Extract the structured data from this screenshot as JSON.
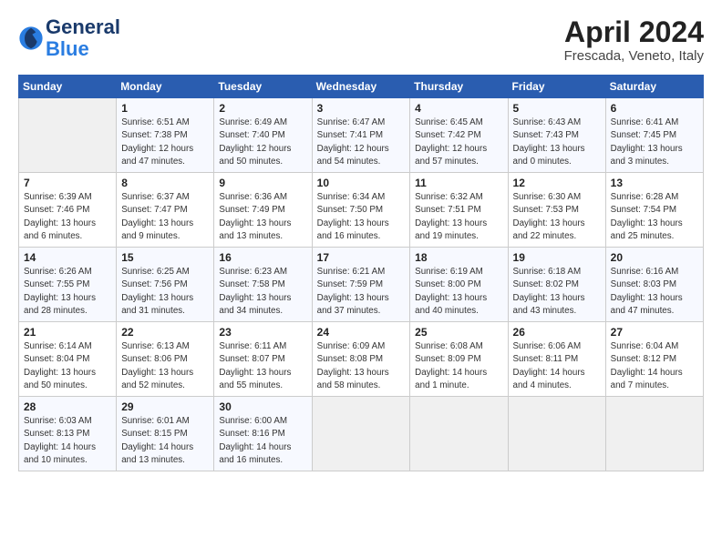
{
  "header": {
    "logo_general": "General",
    "logo_blue": "Blue",
    "title": "April 2024",
    "location": "Frescada, Veneto, Italy"
  },
  "calendar": {
    "headers": [
      "Sunday",
      "Monday",
      "Tuesday",
      "Wednesday",
      "Thursday",
      "Friday",
      "Saturday"
    ],
    "rows": [
      [
        {
          "day": "",
          "info": ""
        },
        {
          "day": "1",
          "info": "Sunrise: 6:51 AM\nSunset: 7:38 PM\nDaylight: 12 hours\nand 47 minutes."
        },
        {
          "day": "2",
          "info": "Sunrise: 6:49 AM\nSunset: 7:40 PM\nDaylight: 12 hours\nand 50 minutes."
        },
        {
          "day": "3",
          "info": "Sunrise: 6:47 AM\nSunset: 7:41 PM\nDaylight: 12 hours\nand 54 minutes."
        },
        {
          "day": "4",
          "info": "Sunrise: 6:45 AM\nSunset: 7:42 PM\nDaylight: 12 hours\nand 57 minutes."
        },
        {
          "day": "5",
          "info": "Sunrise: 6:43 AM\nSunset: 7:43 PM\nDaylight: 13 hours\nand 0 minutes."
        },
        {
          "day": "6",
          "info": "Sunrise: 6:41 AM\nSunset: 7:45 PM\nDaylight: 13 hours\nand 3 minutes."
        }
      ],
      [
        {
          "day": "7",
          "info": "Sunrise: 6:39 AM\nSunset: 7:46 PM\nDaylight: 13 hours\nand 6 minutes."
        },
        {
          "day": "8",
          "info": "Sunrise: 6:37 AM\nSunset: 7:47 PM\nDaylight: 13 hours\nand 9 minutes."
        },
        {
          "day": "9",
          "info": "Sunrise: 6:36 AM\nSunset: 7:49 PM\nDaylight: 13 hours\nand 13 minutes."
        },
        {
          "day": "10",
          "info": "Sunrise: 6:34 AM\nSunset: 7:50 PM\nDaylight: 13 hours\nand 16 minutes."
        },
        {
          "day": "11",
          "info": "Sunrise: 6:32 AM\nSunset: 7:51 PM\nDaylight: 13 hours\nand 19 minutes."
        },
        {
          "day": "12",
          "info": "Sunrise: 6:30 AM\nSunset: 7:53 PM\nDaylight: 13 hours\nand 22 minutes."
        },
        {
          "day": "13",
          "info": "Sunrise: 6:28 AM\nSunset: 7:54 PM\nDaylight: 13 hours\nand 25 minutes."
        }
      ],
      [
        {
          "day": "14",
          "info": "Sunrise: 6:26 AM\nSunset: 7:55 PM\nDaylight: 13 hours\nand 28 minutes."
        },
        {
          "day": "15",
          "info": "Sunrise: 6:25 AM\nSunset: 7:56 PM\nDaylight: 13 hours\nand 31 minutes."
        },
        {
          "day": "16",
          "info": "Sunrise: 6:23 AM\nSunset: 7:58 PM\nDaylight: 13 hours\nand 34 minutes."
        },
        {
          "day": "17",
          "info": "Sunrise: 6:21 AM\nSunset: 7:59 PM\nDaylight: 13 hours\nand 37 minutes."
        },
        {
          "day": "18",
          "info": "Sunrise: 6:19 AM\nSunset: 8:00 PM\nDaylight: 13 hours\nand 40 minutes."
        },
        {
          "day": "19",
          "info": "Sunrise: 6:18 AM\nSunset: 8:02 PM\nDaylight: 13 hours\nand 43 minutes."
        },
        {
          "day": "20",
          "info": "Sunrise: 6:16 AM\nSunset: 8:03 PM\nDaylight: 13 hours\nand 47 minutes."
        }
      ],
      [
        {
          "day": "21",
          "info": "Sunrise: 6:14 AM\nSunset: 8:04 PM\nDaylight: 13 hours\nand 50 minutes."
        },
        {
          "day": "22",
          "info": "Sunrise: 6:13 AM\nSunset: 8:06 PM\nDaylight: 13 hours\nand 52 minutes."
        },
        {
          "day": "23",
          "info": "Sunrise: 6:11 AM\nSunset: 8:07 PM\nDaylight: 13 hours\nand 55 minutes."
        },
        {
          "day": "24",
          "info": "Sunrise: 6:09 AM\nSunset: 8:08 PM\nDaylight: 13 hours\nand 58 minutes."
        },
        {
          "day": "25",
          "info": "Sunrise: 6:08 AM\nSunset: 8:09 PM\nDaylight: 14 hours\nand 1 minute."
        },
        {
          "day": "26",
          "info": "Sunrise: 6:06 AM\nSunset: 8:11 PM\nDaylight: 14 hours\nand 4 minutes."
        },
        {
          "day": "27",
          "info": "Sunrise: 6:04 AM\nSunset: 8:12 PM\nDaylight: 14 hours\nand 7 minutes."
        }
      ],
      [
        {
          "day": "28",
          "info": "Sunrise: 6:03 AM\nSunset: 8:13 PM\nDaylight: 14 hours\nand 10 minutes."
        },
        {
          "day": "29",
          "info": "Sunrise: 6:01 AM\nSunset: 8:15 PM\nDaylight: 14 hours\nand 13 minutes."
        },
        {
          "day": "30",
          "info": "Sunrise: 6:00 AM\nSunset: 8:16 PM\nDaylight: 14 hours\nand 16 minutes."
        },
        {
          "day": "",
          "info": ""
        },
        {
          "day": "",
          "info": ""
        },
        {
          "day": "",
          "info": ""
        },
        {
          "day": "",
          "info": ""
        }
      ]
    ]
  }
}
